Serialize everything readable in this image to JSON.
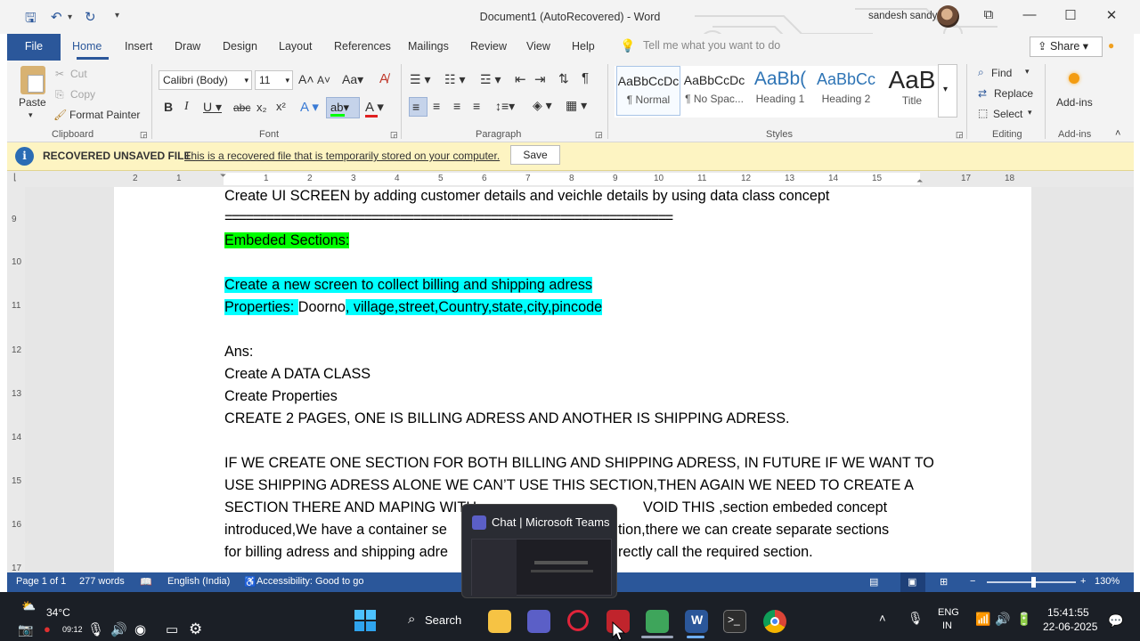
{
  "window": {
    "title": "Document1 (AutoRecovered)  -  Word",
    "user": "sandesh sandy"
  },
  "qat": {
    "save_icon": "save-icon",
    "undo_icon": "undo-icon",
    "redo_icon": "redo-icon"
  },
  "tabs": [
    "File",
    "Home",
    "Insert",
    "Draw",
    "Design",
    "Layout",
    "References",
    "Mailings",
    "Review",
    "View",
    "Help"
  ],
  "tell_me": "Tell me what you want to do",
  "share": "Share",
  "ribbon": {
    "clipboard": {
      "paste": "Paste",
      "cut": "Cut",
      "copy": "Copy",
      "format_painter": "Format Painter",
      "label": "Clipboard"
    },
    "font": {
      "name": "Calibri (Body)",
      "size": "11",
      "label": "Font"
    },
    "paragraph": {
      "label": "Paragraph"
    },
    "styles": {
      "items": [
        {
          "sample": "AaBbCcDc",
          "name": "¶ Normal"
        },
        {
          "sample": "AaBbCcDc",
          "name": "¶ No Spac..."
        },
        {
          "sample": "AaBb(",
          "name": "Heading 1"
        },
        {
          "sample": "AaBbCc",
          "name": "Heading 2"
        },
        {
          "sample": "AaB",
          "name": "Title"
        }
      ],
      "label": "Styles"
    },
    "editing": {
      "find": "Find",
      "replace": "Replace",
      "select": "Select",
      "label": "Editing"
    },
    "addins": {
      "button": "Add-ins",
      "label": "Add-ins"
    }
  },
  "infobar": {
    "title": "RECOVERED UNSAVED FILE",
    "message": "This is a recovered file that is temporarily stored on your computer.",
    "save": "Save"
  },
  "ruler": {
    "numbers": [
      "2",
      "1",
      "1",
      "2",
      "3",
      "4",
      "5",
      "6",
      "7",
      "8",
      "9",
      "10",
      "11",
      "12",
      "13",
      "14",
      "15",
      "16",
      "17",
      "18"
    ]
  },
  "vruler": {
    "numbers": [
      "9",
      "10",
      "11",
      "12",
      "13",
      "14",
      "15",
      "16",
      "17"
    ]
  },
  "document": {
    "l1": "Create UI SCREEN by adding customer details and veichle details by using data class concept",
    "l2": "================================================================",
    "l3": "Embeded Sections:",
    "l5": "Create a new screen to collect billing and shipping adress",
    "l6a": "Properties: ",
    "l6b": "Doorno",
    "l6c": ", village,street,Country,state,city,pincode",
    "l8": "Ans:",
    "l9": "Create  A DATA CLASS",
    "l10": "Create Properties",
    "l11": "CREATE 2 PAGES, ONE IS BILLING ADRESS AND ANOTHER IS SHIPPING ADRESS.",
    "l13": "IF WE CREATE ONE SECTION FOR BOTH BILLING AND SHIPPING ADRESS, IN FUTURE IF WE WANT TO",
    "l14": "USE SHIPPING ADRESS ALONE WE CAN’T USE THIS SECTION,THEN AGAIN WE NEED TO CREATE A",
    "l15": "SECTION THERE AND MAPING WITH",
    "l15b": "VOID THIS ,section embeded concept",
    "l16": "introduced,We have a container se",
    "l16b": "tion,there we can create separate sections",
    "l17": "for billing adress and shipping adre",
    "l17b": "rectly call the required section."
  },
  "status": {
    "page": "Page 1 of 1",
    "words": "277 words",
    "language": "English (India)",
    "accessibility": "Accessibility: Good to go",
    "zoom": "130%"
  },
  "taskbar": {
    "weather": "34°C",
    "rec_time": "09:12",
    "search": "Search",
    "lang1": "ENG",
    "lang2": "IN",
    "time": "15:41:55",
    "date": "22-06-2025"
  },
  "teams_popup": {
    "title": "Chat | Microsoft Teams"
  }
}
